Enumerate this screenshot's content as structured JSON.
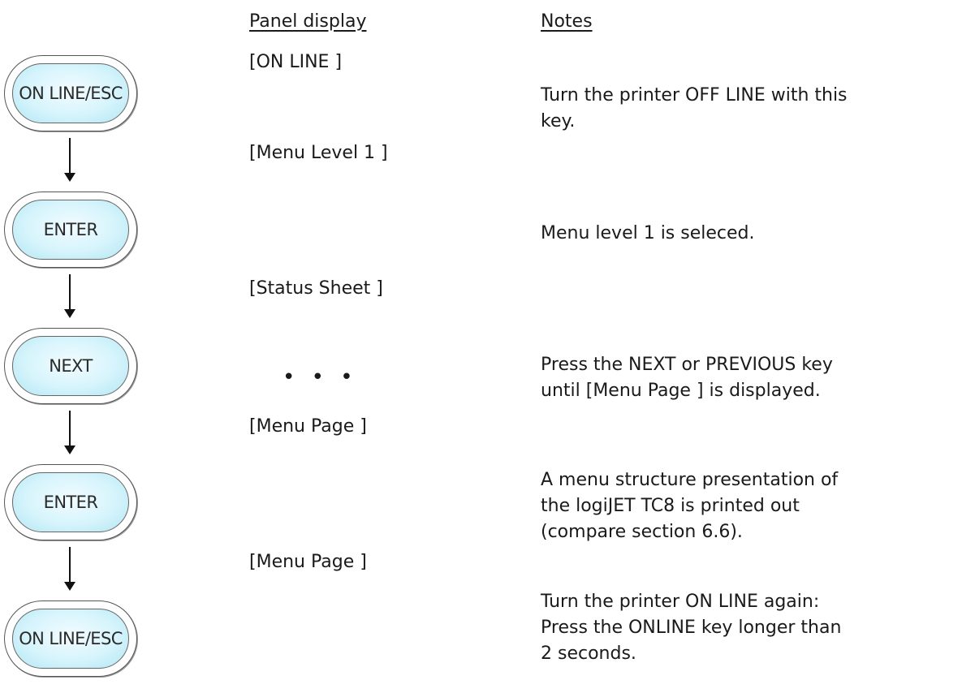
{
  "headers": {
    "panel_display": "Panel display",
    "notes": "Notes"
  },
  "keys": [
    {
      "label": "ON LINE/ESC"
    },
    {
      "label": "ENTER"
    },
    {
      "label": "NEXT"
    },
    {
      "label": "ENTER"
    },
    {
      "label": "ON LINE/ESC"
    }
  ],
  "panel_display": [
    "[ON LINE ]",
    "[Menu Level 1 ]",
    "[Status Sheet ]",
    "• • •",
    "[Menu Page ]",
    "[Menu Page ]"
  ],
  "notes": [
    "Turn the printer OFF LINE with this\nkey.",
    "Menu level 1 is seleced.",
    "Press the NEXT or PREVIOUS key\nuntil [Menu Page ] is displayed.",
    "A menu structure presentation of\nthe logiJET TC8  is printed out\n(compare section 6.6).",
    "Turn the printer ON LINE again:\nPress the ONLINE key longer than\n2 seconds."
  ],
  "colors": {
    "key_fill": "#d6f4fc",
    "key_border": "#555555",
    "text": "#1a1a1a"
  }
}
